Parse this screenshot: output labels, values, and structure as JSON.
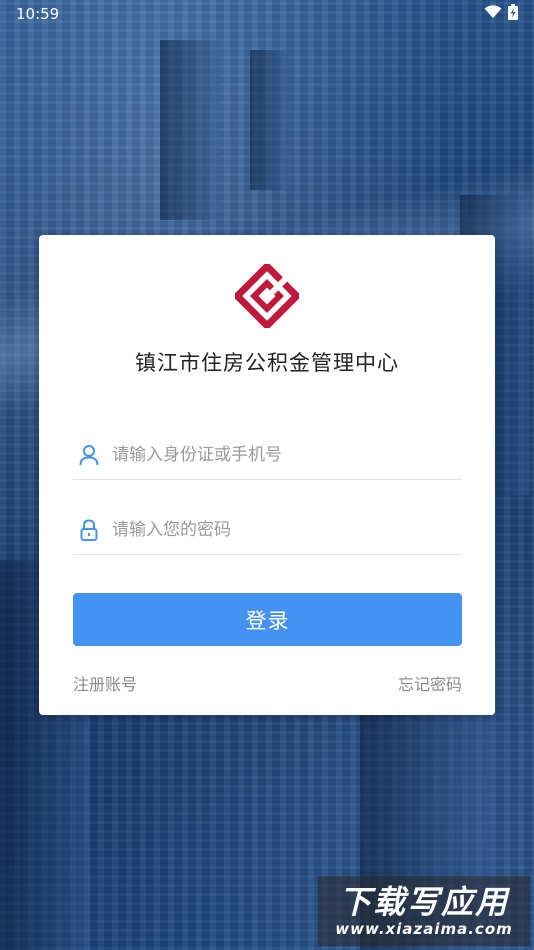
{
  "status_bar": {
    "time": "10:59",
    "icons": [
      "wifi-icon",
      "battery-charging-icon"
    ]
  },
  "app": {
    "title": "镇江市住房公积金管理中心",
    "logo_color": "#c0183a"
  },
  "login_form": {
    "username": {
      "icon": "user-icon",
      "placeholder": "请输入身份证或手机号",
      "value": ""
    },
    "password": {
      "icon": "lock-icon",
      "placeholder": "请输入您的密码",
      "value": ""
    },
    "submit_label": "登录",
    "accent_color": "#4493f2",
    "register_link": "注册账号",
    "forgot_link": "忘记密码"
  },
  "watermark": {
    "main": "下载写应用",
    "sub": "www.xiazaima.com"
  }
}
